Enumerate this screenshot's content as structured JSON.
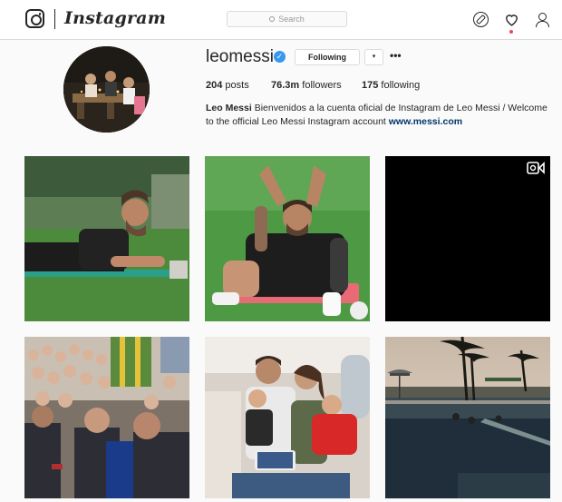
{
  "nav": {
    "wordmark": "Instagram",
    "search_placeholder": "Search",
    "icons": [
      "instagram-logo-icon",
      "explore-compass-icon",
      "activity-heart-icon",
      "profile-person-icon"
    ]
  },
  "profile": {
    "username": "leomessi",
    "verified": true,
    "follow_button": "Following",
    "dropdown_symbol": "▾",
    "more_symbol": "•••",
    "stats": {
      "posts_count": "204",
      "posts_label": "posts",
      "followers_count": "76.3m",
      "followers_label": "followers",
      "following_count": "175",
      "following_label": "following"
    },
    "full_name": "Leo Messi",
    "bio_text": "Bienvenidos a la cuenta oficial de Instagram de Leo Messi / Welcome to the official Leo Messi Instagram account",
    "website": "www.messi.com"
  },
  "posts": [
    {
      "type": "photo"
    },
    {
      "type": "photo"
    },
    {
      "type": "video"
    },
    {
      "type": "photo"
    },
    {
      "type": "photo"
    },
    {
      "type": "photo"
    }
  ],
  "colors": {
    "accent_blue": "#3897f0",
    "link_blue": "#003569",
    "border": "#dbdbdb",
    "notification_red": "#ed4956",
    "background": "#fafafa"
  }
}
